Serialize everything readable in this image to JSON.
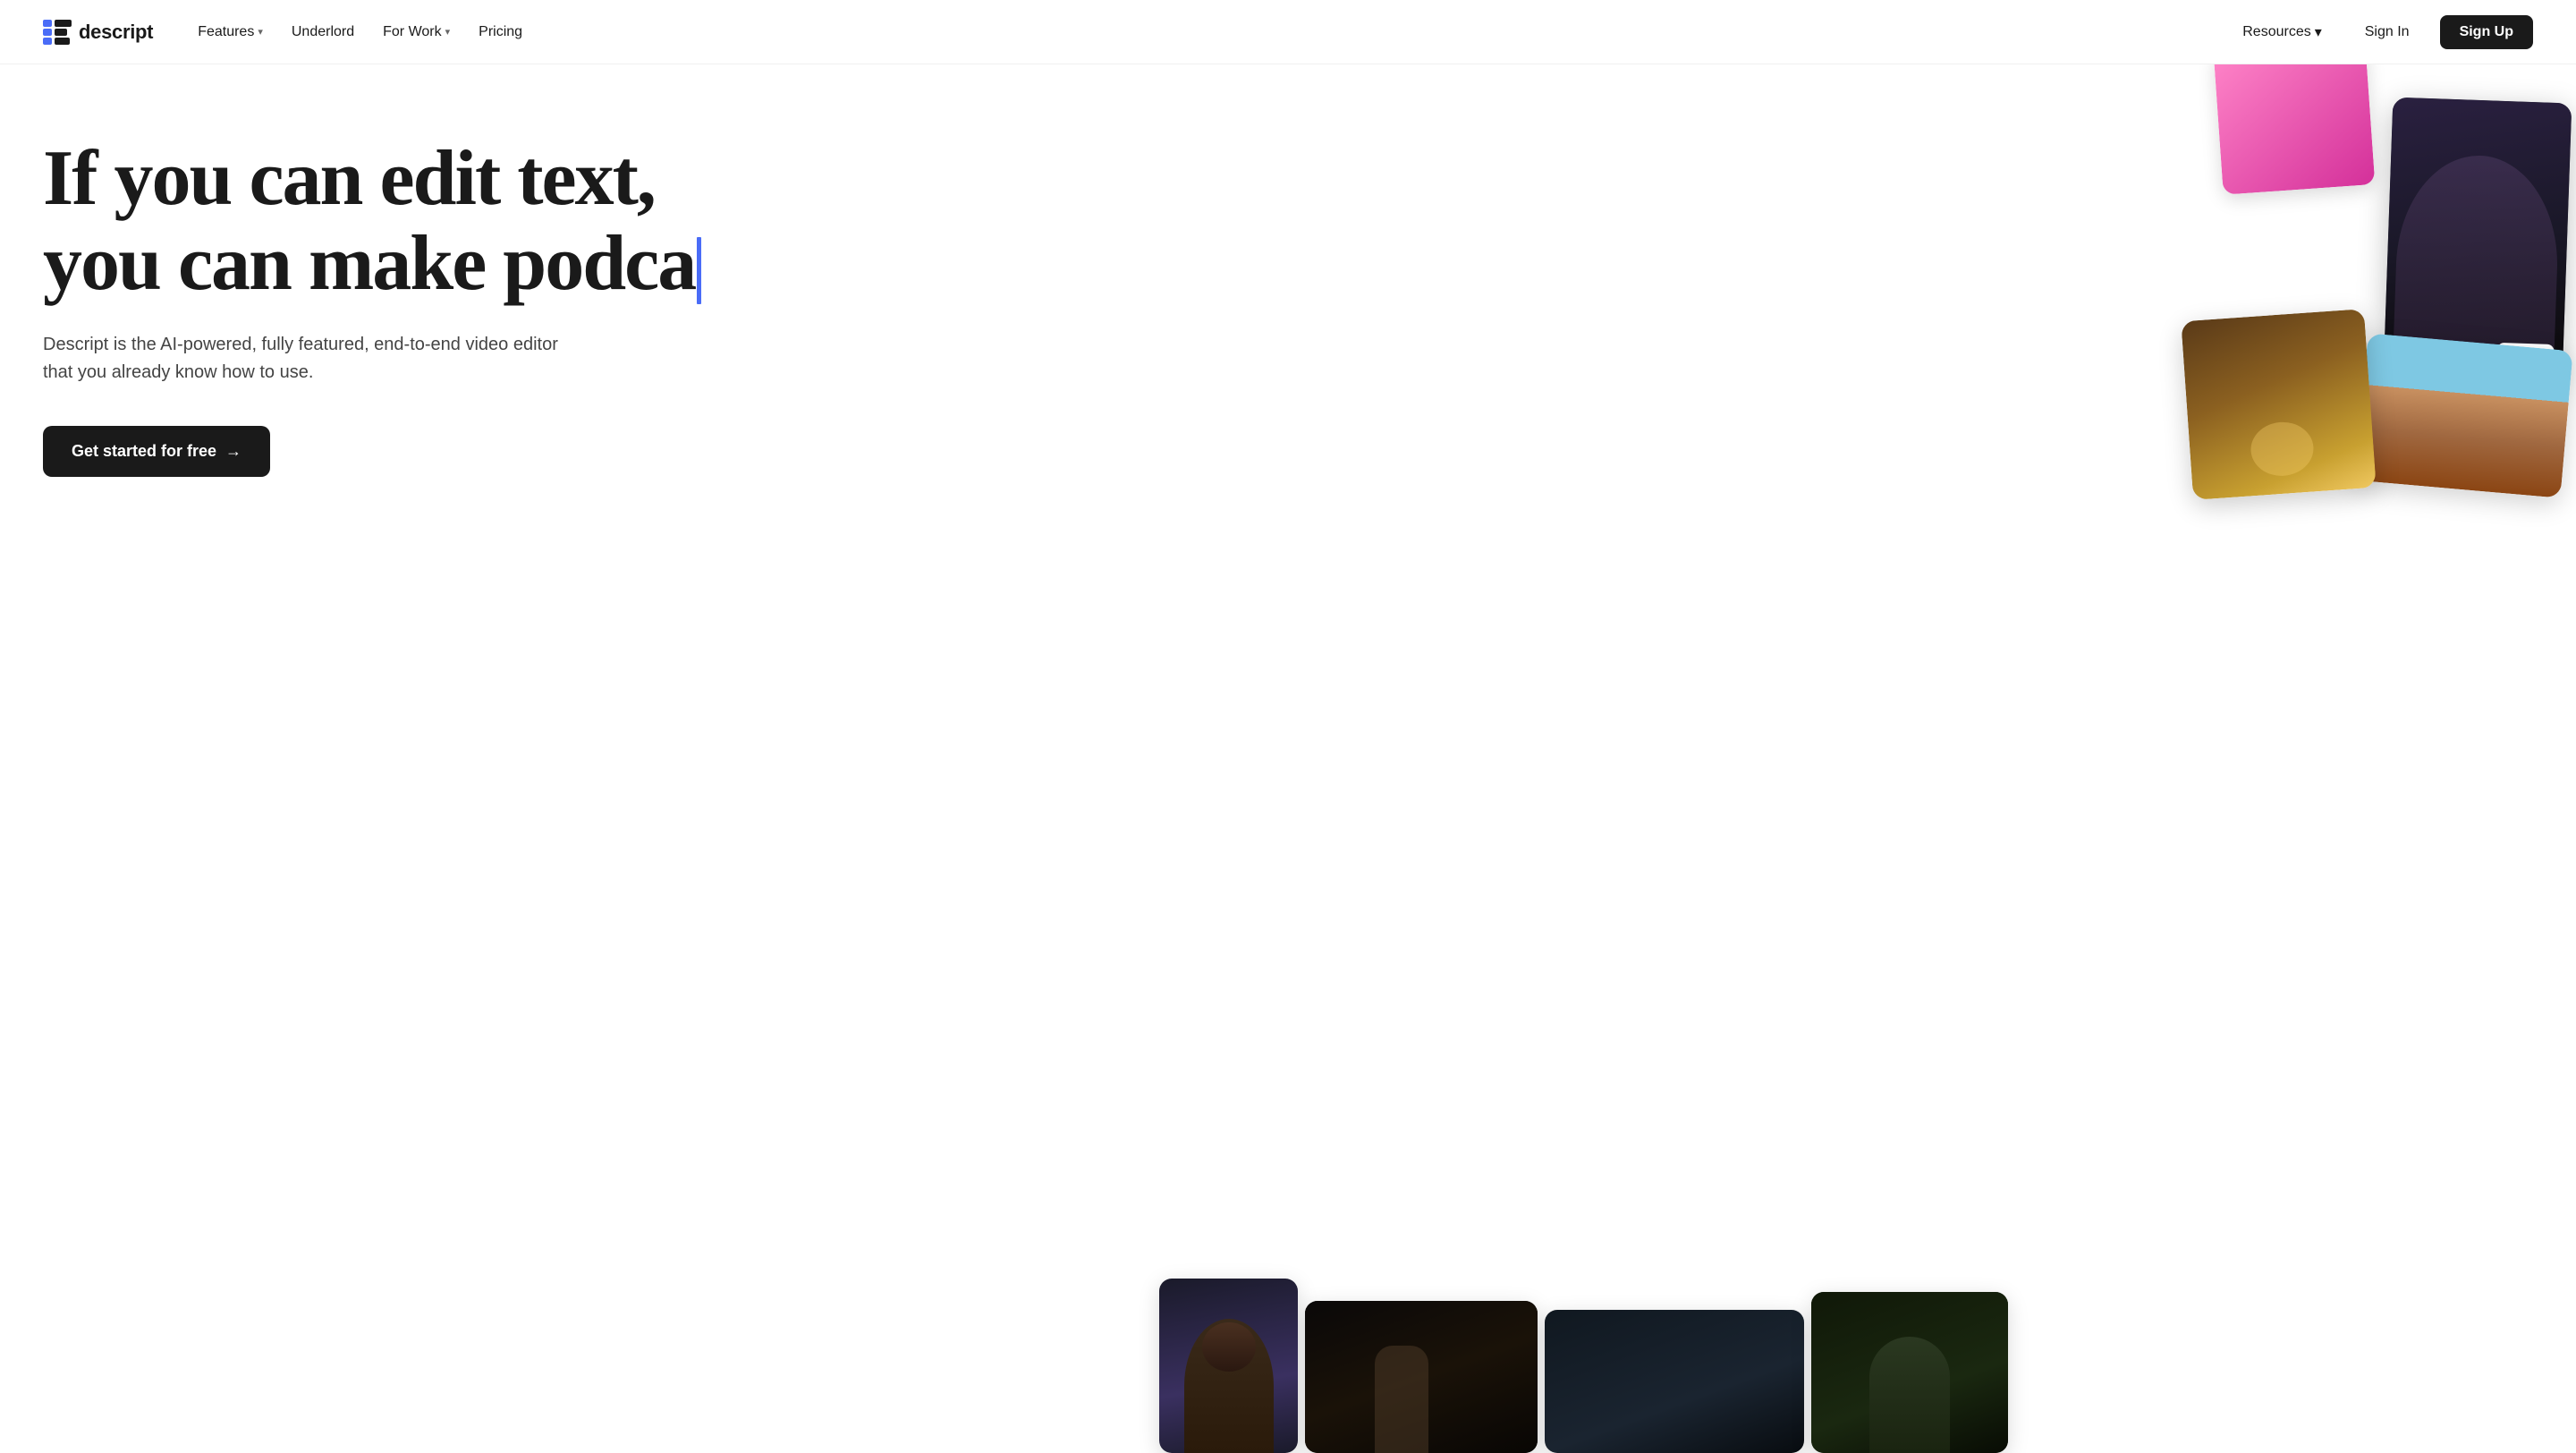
{
  "nav": {
    "logo_text": "descript",
    "links": [
      {
        "label": "Features",
        "has_dropdown": true,
        "id": "features"
      },
      {
        "label": "Underlord",
        "has_dropdown": false,
        "id": "underlord"
      },
      {
        "label": "For Work",
        "has_dropdown": true,
        "id": "for-work"
      },
      {
        "label": "Pricing",
        "has_dropdown": false,
        "id": "pricing"
      }
    ],
    "resources_label": "Resources",
    "sign_in_label": "Sign In",
    "sign_up_label": "Sign Up"
  },
  "hero": {
    "headline_line1": "If you can edit text,",
    "headline_line2": "you can make podca",
    "subtext": "Descript is the AI-powered, fully featured, end-to-end video editor that you already know how to use.",
    "cta_label": "Get started for free",
    "cta_arrow": "→"
  },
  "colors": {
    "cursor": "#4a6cf7",
    "cta_bg": "#1a1a1a",
    "nav_signup_bg": "#1a1a1a"
  }
}
